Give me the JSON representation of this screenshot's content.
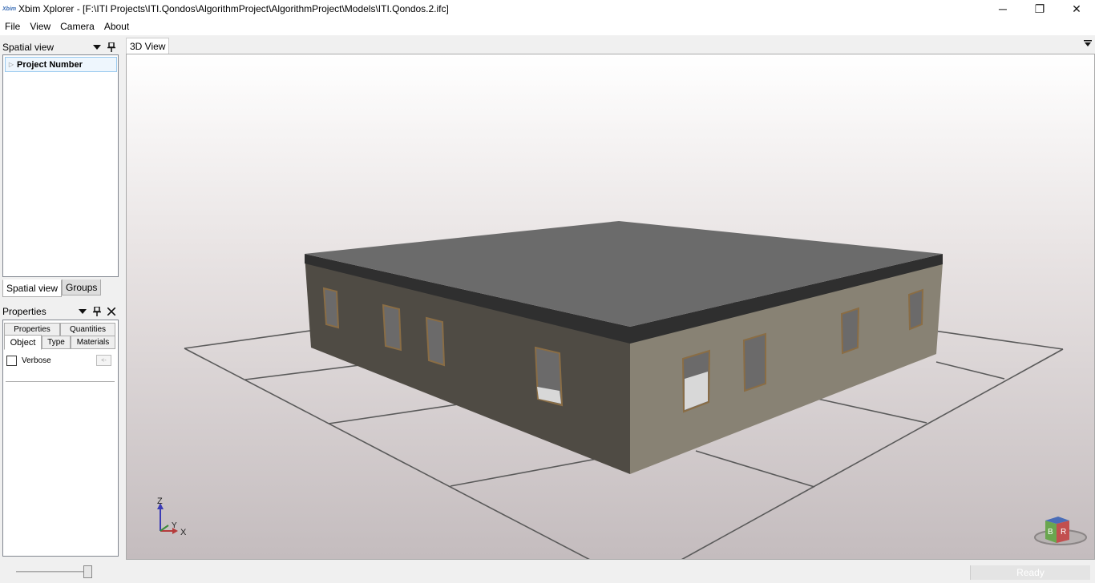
{
  "window": {
    "app_icon": "xbim-logo-icon",
    "app_icon_text": "Xbim",
    "title": "Xbim Xplorer - [F:\\ITI Projects\\ITI.Qondos\\AlgorithmProject\\AlgorithmProject\\Models\\ITI.Qondos.2.ifc]",
    "minimize_glyph": "─",
    "maximize_glyph": "❐",
    "close_glyph": "✕"
  },
  "menu": {
    "items": [
      "File",
      "View",
      "Camera",
      "About"
    ]
  },
  "spatial_pane": {
    "title": "Spatial view",
    "dropdown_glyph": "▼",
    "pin_glyph": "📌",
    "tree": [
      {
        "label": "Project Number",
        "expander": "▷"
      }
    ],
    "tabs": [
      "Spatial view",
      "Groups"
    ],
    "active_tab": "Spatial view"
  },
  "properties_pane": {
    "title": "Properties",
    "dropdown_glyph": "▼",
    "pin_glyph": "📌",
    "close_glyph": "✕",
    "tabs_row1": [
      "Properties",
      "Quantities"
    ],
    "tabs_row2": [
      "Object",
      "Type",
      "Materials"
    ],
    "active_tab": "Object",
    "verbose_label": "Verbose",
    "verbose_checked": false,
    "back_button": "<-"
  },
  "view": {
    "tab_label": "3D View",
    "menu_glyph": "▼",
    "axes": {
      "z": "Z",
      "y": "Y",
      "x": "X"
    },
    "navcube": {
      "left_face": "B",
      "right_face": "R"
    },
    "colors": {
      "roof_top": "#6b6b6b",
      "roof_edge": "#2f2f2f",
      "wall_left": "#4f4b44",
      "wall_right": "#888274",
      "grid_line": "#555555"
    }
  },
  "status": {
    "text": "Ready"
  }
}
